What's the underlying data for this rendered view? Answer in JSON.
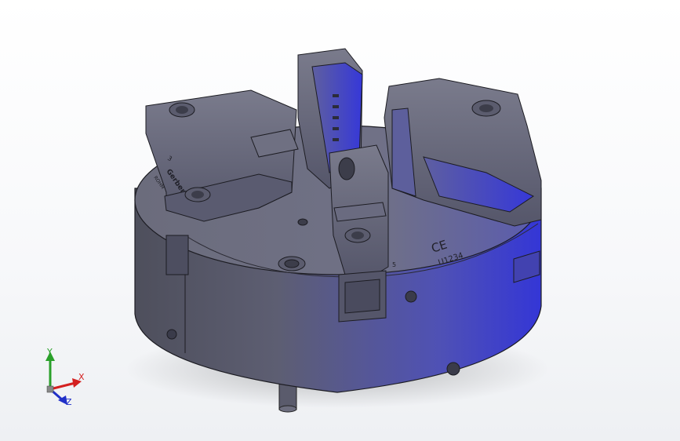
{
  "viewport": {
    "background": "#ffffff"
  },
  "model": {
    "part_color": "#5c5f7a",
    "highlight_color": "#3a3bd9",
    "engravings": {
      "ce_mark": "CE",
      "serial": "U1234",
      "jaw_number_left": "3",
      "jaw_number_front": "5",
      "brand": "Gerber",
      "code": "ROHM"
    }
  },
  "triad": {
    "x_label": "X",
    "y_label": "Y",
    "z_label": "Z",
    "x_color": "#d42020",
    "y_color": "#2aa02a",
    "z_color": "#2030c8"
  }
}
